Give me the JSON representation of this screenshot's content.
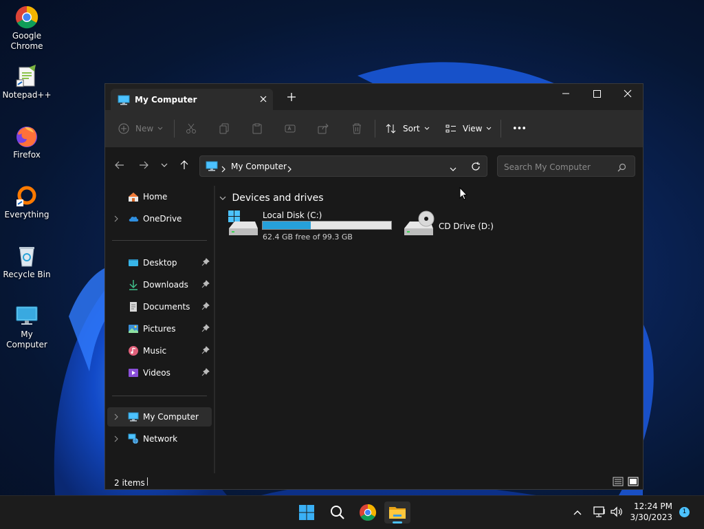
{
  "desktop": {
    "icons": [
      {
        "label": "Google Chrome",
        "icon": "chrome-icon"
      },
      {
        "label": "Notepad++",
        "icon": "notepadpp-icon"
      },
      {
        "label": "Firefox",
        "icon": "firefox-icon"
      },
      {
        "label": "Everything",
        "icon": "everything-icon"
      },
      {
        "label": "Recycle Bin",
        "icon": "recycle-bin-icon"
      },
      {
        "label": "My Computer",
        "icon": "computer-icon"
      }
    ]
  },
  "window": {
    "tab_title": "My Computer",
    "toolbar": {
      "new_label": "New",
      "sort_label": "Sort",
      "view_label": "View",
      "more_label": "•••"
    },
    "address": {
      "segment": "My Computer"
    },
    "search": {
      "placeholder": "Search My Computer"
    },
    "sidebar": {
      "top": [
        {
          "label": "Home",
          "icon": "home-icon"
        },
        {
          "label": "OneDrive",
          "icon": "onedrive-icon"
        }
      ],
      "pinned": [
        {
          "label": "Desktop",
          "icon": "desktop-folder-icon"
        },
        {
          "label": "Downloads",
          "icon": "downloads-icon"
        },
        {
          "label": "Documents",
          "icon": "documents-icon"
        },
        {
          "label": "Pictures",
          "icon": "pictures-icon"
        },
        {
          "label": "Music",
          "icon": "music-icon"
        },
        {
          "label": "Videos",
          "icon": "videos-icon"
        }
      ],
      "bottom": [
        {
          "label": "My Computer",
          "icon": "computer-icon",
          "selected": true
        },
        {
          "label": "Network",
          "icon": "network-icon"
        }
      ]
    },
    "content": {
      "group_title": "Devices and drives",
      "drives": [
        {
          "name": "Local Disk (C:)",
          "detail": "62.4 GB free of 99.3 GB",
          "used_fraction": 0.372
        },
        {
          "name": "CD Drive (D:)"
        }
      ]
    },
    "status": {
      "items": "2 items"
    }
  },
  "taskbar": {
    "time": "12:24 PM",
    "date": "3/30/2023",
    "notification_count": "1"
  },
  "colors": {
    "accent": "#4cc2ff",
    "drive_bar": "#26a0da",
    "window_bg": "#191919",
    "toolbar_bg": "#2c2c2c"
  }
}
